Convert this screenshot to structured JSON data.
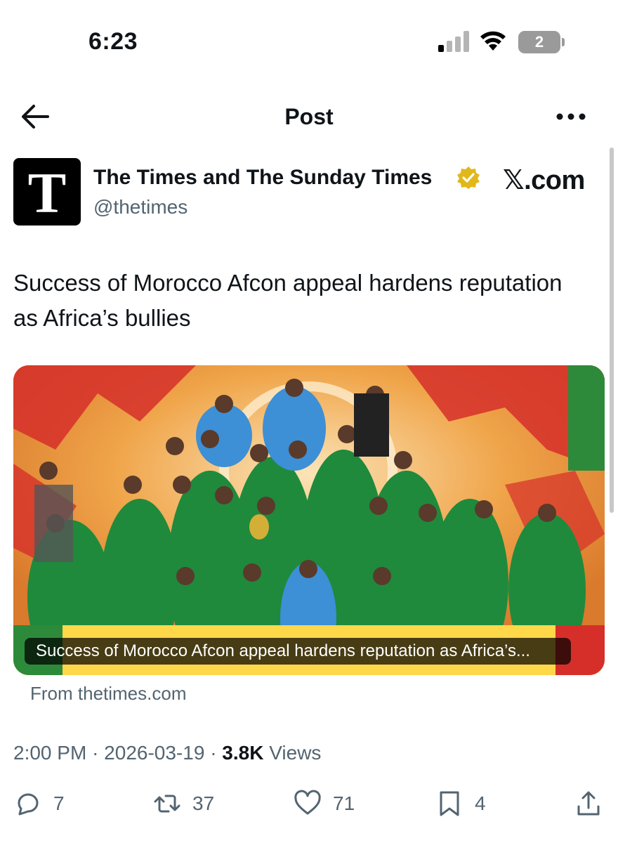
{
  "status_bar": {
    "time": "6:23",
    "battery_level": "2",
    "signal_bars_active": 1
  },
  "nav": {
    "title": "Post"
  },
  "author": {
    "avatar_letter": "T",
    "name": "The Times and The Sunday Times",
    "handle": "@thetimes",
    "verified": true,
    "verified_color": "#e2b719",
    "watermark": "𝕏.com"
  },
  "tweet": {
    "text": "Success of Morocco Afcon appeal hardens reputation as Africa’s bullies"
  },
  "card": {
    "caption": "Success of Morocco Afcon appeal hardens reputation as Africa’s...",
    "source": "From thetimes.com",
    "image_description_colors": {
      "jersey_green": "#1f8a3c",
      "keeper_blue": "#3d8fd6",
      "backdrop_red": "#d62f2a",
      "backdrop_orange": "#f0a54a"
    }
  },
  "meta": {
    "time": "2:00 PM",
    "separator": "·",
    "date": "2026-03-19",
    "views_count": "3.8K",
    "views_label": "Views"
  },
  "actions": {
    "replies": "7",
    "reposts": "37",
    "likes": "71",
    "bookmarks": "4"
  }
}
